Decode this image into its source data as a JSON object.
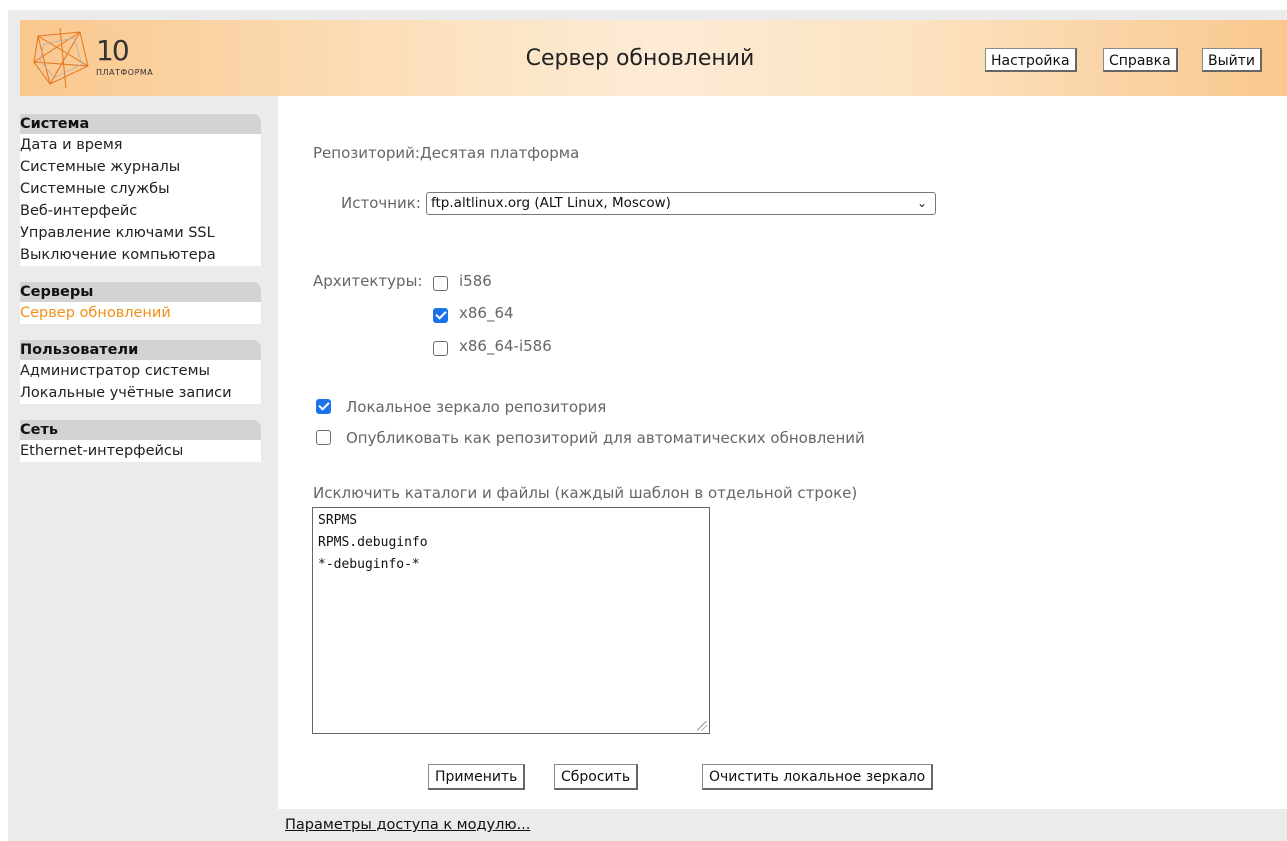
{
  "app": {
    "logo_number": "10",
    "logo_text": "ПЛАТФОРМА",
    "title": "Сервер обновлений"
  },
  "header_buttons": {
    "settings": "Настройка",
    "help": "Справка",
    "logout": "Выйти"
  },
  "sidebar": {
    "groups": [
      {
        "title": "Система",
        "items": [
          "Дата и время",
          "Системные журналы",
          "Системные службы",
          "Веб-интерфейс",
          "Управление ключами SSL",
          "Выключение компьютера"
        ]
      },
      {
        "title": "Серверы",
        "items": [
          "Сервер обновлений"
        ]
      },
      {
        "title": "Пользователи",
        "items": [
          "Администратор системы",
          "Локальные учётные записи"
        ]
      },
      {
        "title": "Сеть",
        "items": [
          "Ethernet-интерфейсы"
        ]
      }
    ],
    "active_item": "Сервер обновлений"
  },
  "form": {
    "repo_label": "Репозиторий:",
    "repo_value": "Десятая платформа",
    "source_label": "Источник:",
    "source_value": "ftp.altlinux.org (ALT Linux, Moscow)",
    "arch_label": "Архитектуры:",
    "architectures": [
      {
        "name": "i586",
        "checked": false
      },
      {
        "name": "x86_64",
        "checked": true
      },
      {
        "name": "x86_64-i586",
        "checked": false
      }
    ],
    "local_mirror_label": "Локальное зеркало репозитория",
    "local_mirror_checked": true,
    "publish_label": "Опубликовать как репозиторий для автоматических обновлений",
    "publish_checked": false,
    "exclude_label": "Исключить каталоги и файлы (каждый шаблон в отдельной строке)",
    "exclude_lines": [
      "SRPMS",
      "RPMS.debuginfo",
      "*-debuginfo-*"
    ]
  },
  "actions": {
    "apply": "Применить",
    "reset": "Сбросить",
    "clear_mirror": "Очистить локальное зеркало"
  },
  "footer": {
    "module_access_link": "Параметры доступа к модулю..."
  },
  "colors": {
    "accent": "#f0901a",
    "checkbox": "#1a73e8",
    "header_gradient_edge": "#f9c78d"
  }
}
